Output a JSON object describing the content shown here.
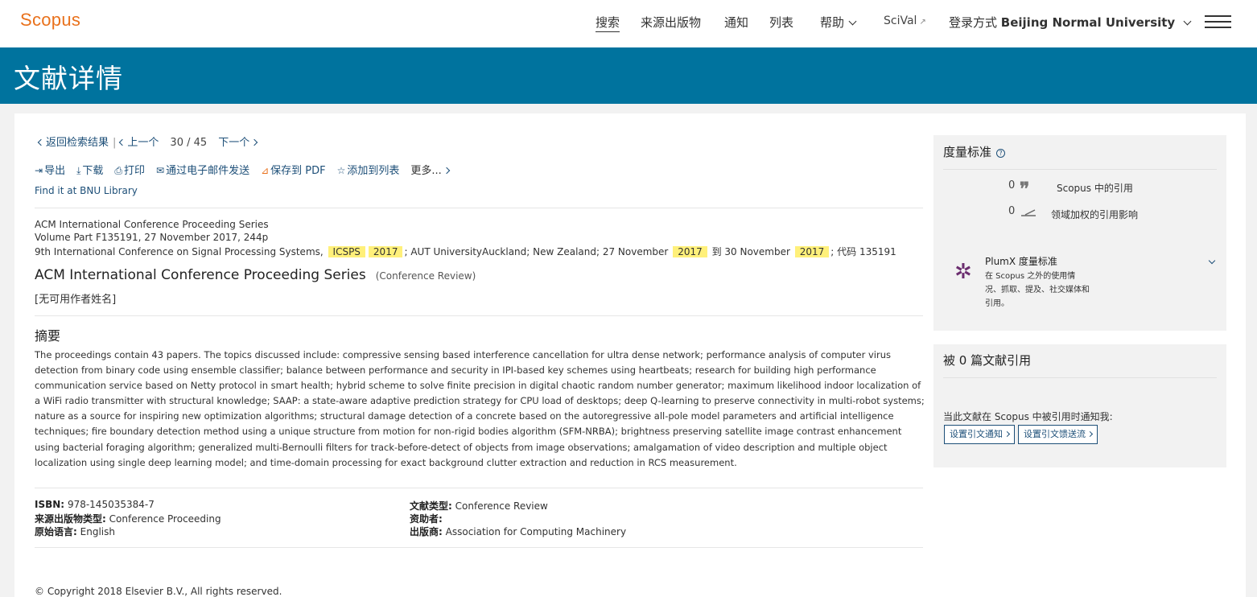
{
  "header": {
    "logo": "Scopus",
    "nav": {
      "search": "搜索",
      "sources": "来源出版物",
      "alerts": "通知",
      "lists": "列表",
      "help": "帮助",
      "scival": "SciVal",
      "scival_ext": "↗",
      "login_prefix": "登录方式",
      "login_institution": "Beijing Normal University"
    }
  },
  "banner": {
    "title": "文献详情"
  },
  "pager": {
    "back": "返回检索结果",
    "prev": "上一个",
    "current": "30",
    "slash": "/",
    "total": "45",
    "next": "下一个"
  },
  "actions": {
    "export": "导出",
    "download": "下载",
    "print": "打印",
    "email": "通过电子邮件发送",
    "save_pdf": "保存到 PDF",
    "add_list": "添加到列表",
    "more": "更多...",
    "find_it": "Find it at BNU Library"
  },
  "source": {
    "line1": "ACM International Conference Proceeding Series",
    "line2": "Volume Part F135191, 27 November 2017, 244p",
    "line3_a": "9th International Conference on Signal Processing Systems,",
    "hl1": "ICSPS",
    "hl2": "2017",
    "line3_b": "; AUT UniversityAuckland; New Zealand; 27 November",
    "hl3": "2017",
    "line3_c": "到 30 November",
    "hl4": "2017",
    "line3_d": "; 代码 135191"
  },
  "document": {
    "title": "ACM International Conference Proceeding Series",
    "doc_type": "(Conference Review)",
    "authors": "[无可用作者姓名]"
  },
  "abstract": {
    "heading": "摘要",
    "text": "The proceedings contain 43 papers. The topics discussed include: compressive sensing based interference cancellation for ultra dense network; performance analysis of computer virus detection from binary code using ensemble classifier; balance between performance and security in IPI-based key schemes using heartbeats; research for building high performance communication service based on Netty protocol in smart health; hybrid scheme to solve finite precision in digital chaotic random number generator; maximum likelihood indoor localization of a WiFi radio transmitter with structural knowledge; SAAP: a state-aware adaptive prediction strategy for CPU load of desktops; deep Q-learning to preserve connectivity in multi-robot systems; nature as a source for inspiring new optimization algorithms; structural damage detection of a concrete based on the autoregressive all-pole model parameters and artificial intelligence techniques; fire boundary detection method using a unique structure from motion for non-rigid bodies algorithm (SFM-NRBA); brightness preserving satellite image contrast enhancement using bacterial foraging algorithm; generalized multi-Bernoulli filters for track-before-detect of objects from image observations; amalgamation of video description and multiple object localization using single deep learning model; and time-domain processing for exact background clutter extraction and reduction in RCS measurement."
  },
  "meta": {
    "isbn_label": "ISBN:",
    "isbn": "978-145035384-7",
    "source_type_label": "来源出版物类型:",
    "source_type": "Conference Proceeding",
    "language_label": "原始语言:",
    "language": "English",
    "doc_type_label": "文献类型:",
    "doc_type": "Conference Review",
    "sponsor_label": "资助者:",
    "sponsor": "",
    "publisher_label": "出版商:",
    "publisher": "Association for Computing Machinery"
  },
  "footer": {
    "copyright": "© Copyright 2018 Elsevier B.V., All rights reserved."
  },
  "metrics": {
    "heading": "度量标准",
    "help": "?",
    "citations_count": "0",
    "citations_label": "Scopus 中的引用",
    "fwci_count": "0",
    "fwci_label": "领域加权的引用影响",
    "plumx_title": "PlumX 度量标准",
    "plumx_desc": "在 Scopus 之外的使用情况、抓取、提及、社交媒体和引用。"
  },
  "cited_by": {
    "heading": "被 0 篇文献引用",
    "notify_text": "当此文献在 Scopus 中被引用时通知我:",
    "alert_btn": "设置引文通知",
    "feed_btn": "设置引文馈送流"
  }
}
